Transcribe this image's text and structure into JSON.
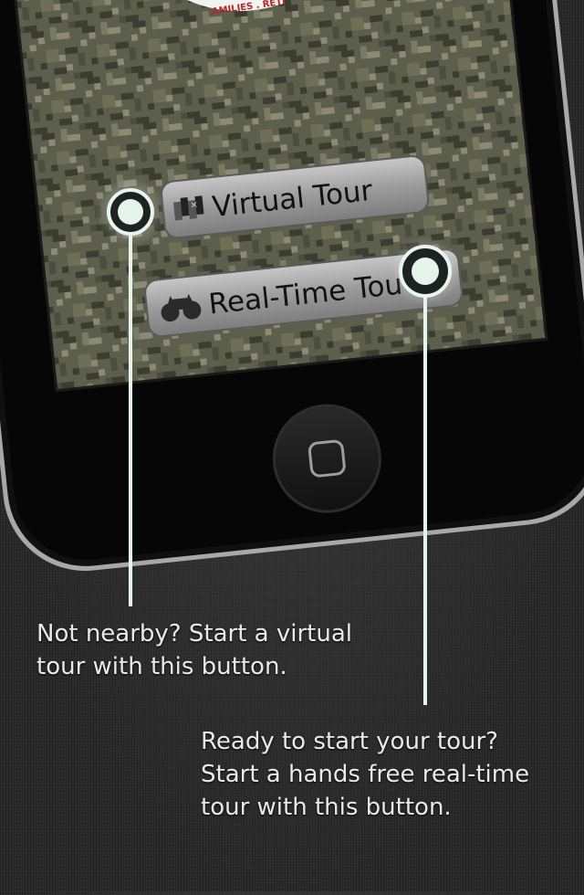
{
  "seal_fragment": "AMILIES . RETI",
  "buttons": {
    "virtual_tour": {
      "label": "Virtual Tour",
      "icon": "map-icon"
    },
    "realtime_tour": {
      "label": "Real-Time Tou",
      "icon": "binoculars-icon"
    }
  },
  "callouts": {
    "virtual": {
      "line1": "Not nearby? Start a virtual",
      "line2": "tour with this button."
    },
    "realtime": {
      "line1": "Ready to start your tour?",
      "line2": "Start a hands free real-time",
      "line3": "tour with this button."
    }
  },
  "colors": {
    "camo_base": "#5b5f4b",
    "camo_dark": "#3b3d30",
    "camo_light": "#8c8a75",
    "glow": "#dff0e6",
    "button_fill": "#9a9a9a"
  }
}
